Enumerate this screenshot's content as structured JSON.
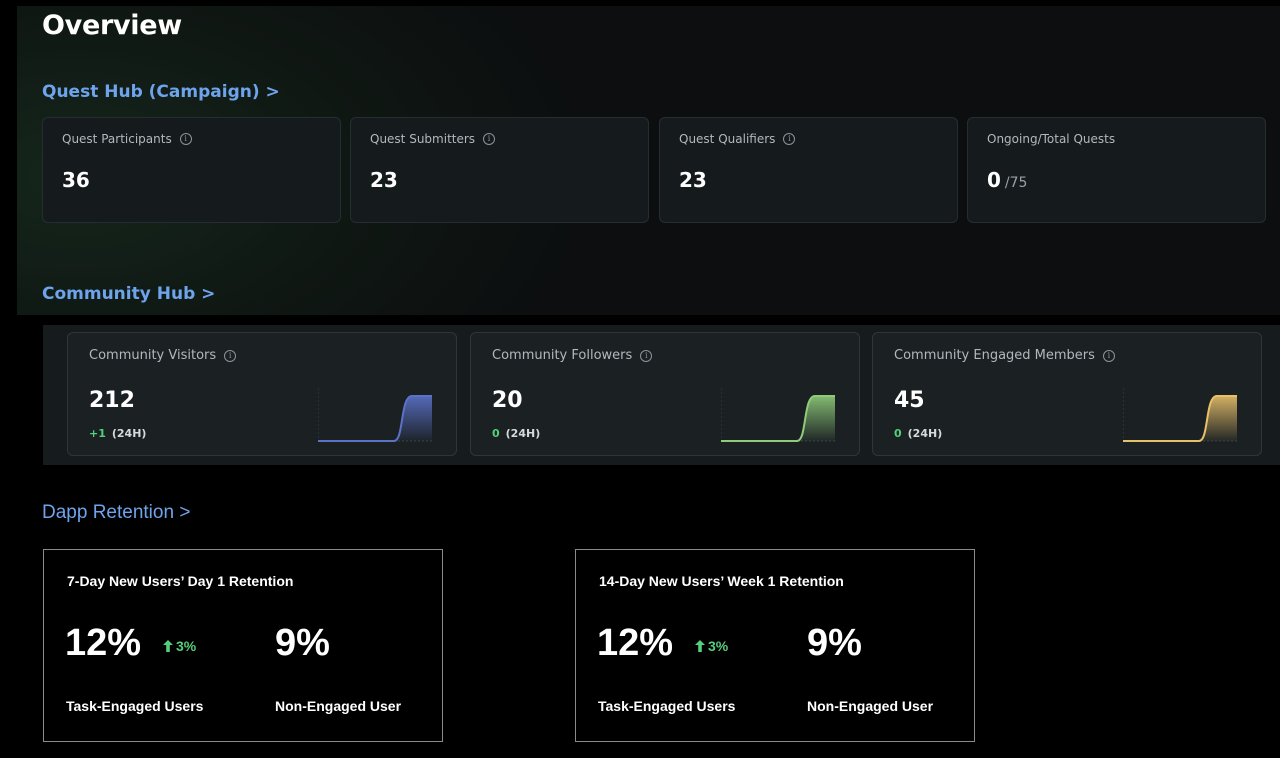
{
  "page": {
    "title": "Overview"
  },
  "quest_hub": {
    "link": "Quest Hub (Campaign) >",
    "cards": [
      {
        "label": "Quest Participants",
        "value": "36",
        "info": true
      },
      {
        "label": "Quest Submitters",
        "value": "23",
        "info": true
      },
      {
        "label": "Quest Qualifiers",
        "value": "23",
        "info": true
      },
      {
        "label": "Ongoing/Total Quests",
        "value": "0",
        "total": "/75",
        "info": false
      }
    ]
  },
  "community_hub": {
    "link": "Community Hub >",
    "cards": [
      {
        "label": "Community Visitors",
        "value": "212",
        "delta": "+1",
        "period": "(24H)",
        "color": "#5b72c9"
      },
      {
        "label": "Community Followers",
        "value": "20",
        "delta": "0",
        "period": "(24H)",
        "color": "#8fcb7a"
      },
      {
        "label": "Community Engaged Members",
        "value": "45",
        "delta": "0",
        "period": "(24H)",
        "color": "#e7c06a"
      }
    ]
  },
  "dapp_retention": {
    "link": "Dapp Retention >",
    "cards": [
      {
        "title": "7-Day New Users’ Day 1 Retention",
        "engaged_pct": "12%",
        "change": "3%",
        "non_engaged_pct": "9%",
        "engaged_label": "Task-Engaged Users",
        "non_engaged_label": "Non-Engaged User"
      },
      {
        "title": "14-Day New Users’ Week 1 Retention",
        "engaged_pct": "12%",
        "change": "3%",
        "non_engaged_pct": "9%",
        "engaged_label": "Task-Engaged Users",
        "non_engaged_label": "Non-Engaged User"
      }
    ]
  },
  "colors": {
    "accent_link": "#6ea4ec",
    "positive": "#52d07b"
  },
  "icons": {
    "info": "info-circle-icon",
    "up": "arrow-up-icon"
  }
}
